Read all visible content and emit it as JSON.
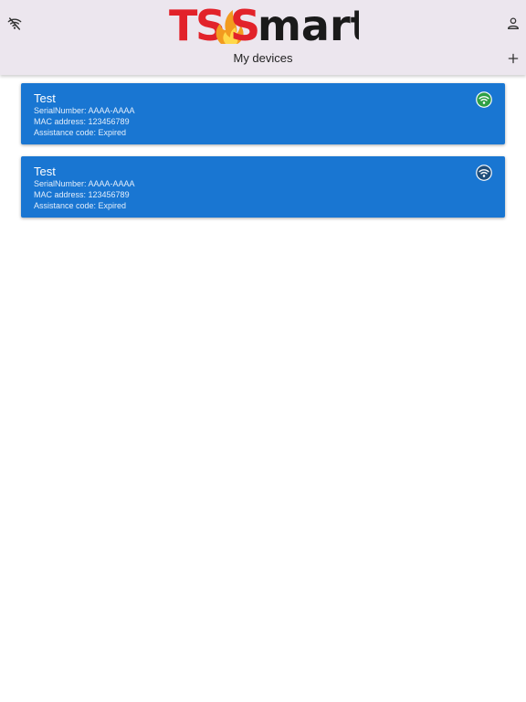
{
  "header": {
    "logo_text": "TSSmart",
    "title": "My devices",
    "icons": {
      "left": "wifi-off-icon",
      "right": "person-icon",
      "add": "add-icon"
    }
  },
  "devices": [
    {
      "name": "Test",
      "serial_label": "SerialNumber: AAAA-AAAA",
      "mac_label": "MAC address: 123456789",
      "assistance_label": "Assistance code: Expired",
      "status_icon": "wifi-icon",
      "status_color": "#2e9f44"
    },
    {
      "name": "Test",
      "serial_label": "SerialNumber: AAAA-AAAA",
      "mac_label": "MAC address: 123456789",
      "assistance_label": "Assistance code: Expired",
      "status_icon": "wifi-icon",
      "status_color": "#1f4d7a"
    }
  ],
  "colors": {
    "header_bg": "#ece6ee",
    "card_bg": "#1976d2",
    "logo_red": "#e2222a",
    "logo_dark": "#1a1a1a"
  }
}
